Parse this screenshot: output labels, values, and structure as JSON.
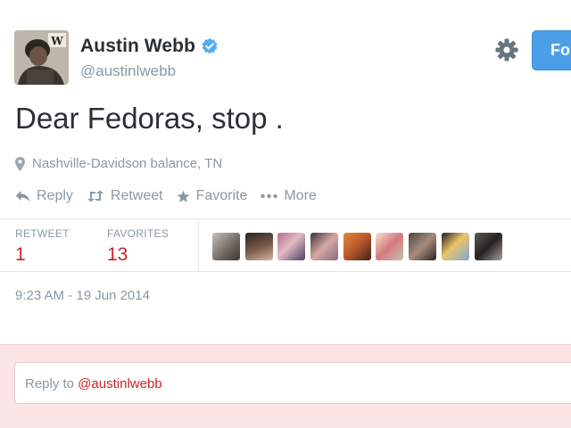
{
  "user": {
    "name": "Austin Webb",
    "handle": "@austinlwebb",
    "verified": true
  },
  "header": {
    "follow_label": "Fo"
  },
  "tweet": {
    "text": "Dear Fedoras, stop .",
    "location": "Nashville-Davidson balance, TN",
    "timestamp": "9:23 AM - 19 Jun 2014"
  },
  "actions": {
    "reply": "Reply",
    "retweet": "Retweet",
    "favorite": "Favorite",
    "more": "More"
  },
  "stats": {
    "retweets_label": "RETWEET",
    "retweets_value": "1",
    "favorites_label": "FAVORITES",
    "favorites_value": "13"
  },
  "reply": {
    "prefix": "Reply to",
    "mention": "@austinlwebb"
  },
  "colors": {
    "accent_blue": "#4a9fe8",
    "count_red": "#cc2229",
    "muted_gray": "#8899a6",
    "reply_bg": "#fbe4e6"
  }
}
